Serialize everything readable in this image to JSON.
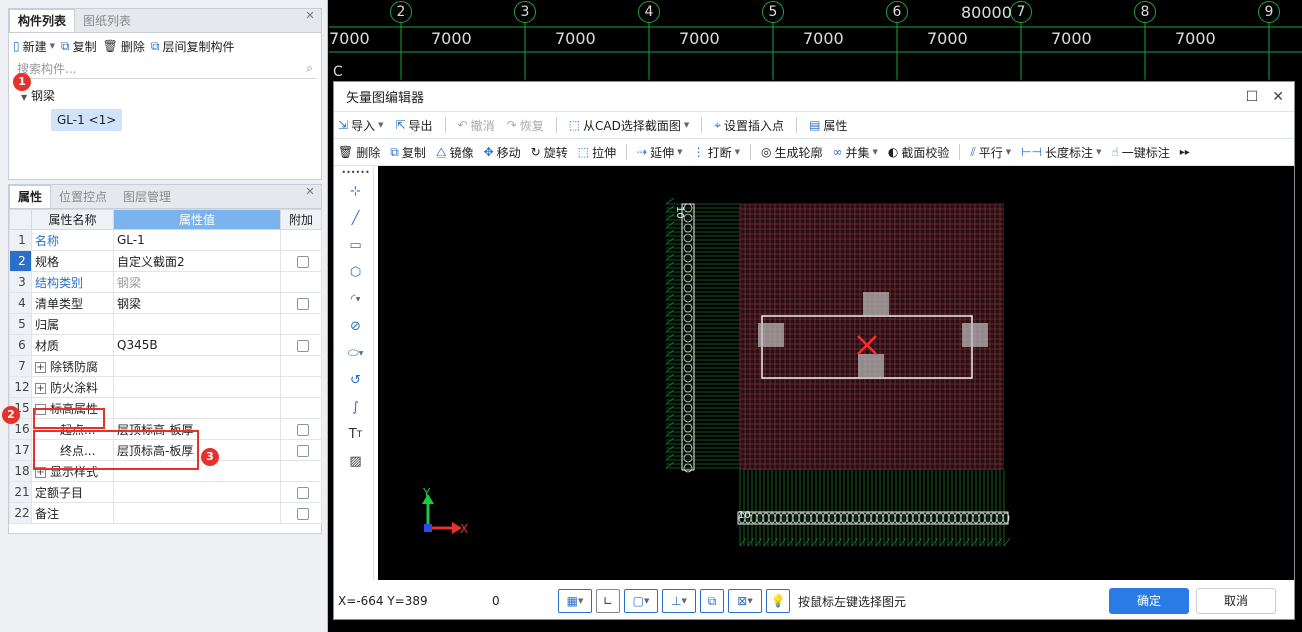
{
  "component_panel": {
    "tabs": [
      "构件列表",
      "图纸列表"
    ],
    "toolbar": {
      "new": "新建",
      "copy": "复制",
      "delete": "删除",
      "floor_copy": "层间复制构件"
    },
    "search_placeholder": "搜索构件...",
    "tree": {
      "group": "钢梁",
      "child": "GL-1 <1>"
    }
  },
  "property_panel": {
    "tabs": [
      "属性",
      "位置控点",
      "图层管理"
    ],
    "headers": {
      "name": "属性名称",
      "value": "属性值",
      "extra": "附加"
    },
    "rows": [
      {
        "num": "1",
        "name": "名称",
        "value": "GL-1"
      },
      {
        "num": "2",
        "name": "规格",
        "value": "自定义截面2"
      },
      {
        "num": "3",
        "name": "结构类别",
        "value": "钢梁"
      },
      {
        "num": "4",
        "name": "清单类型",
        "value": "钢梁"
      },
      {
        "num": "5",
        "name": "归属",
        "value": ""
      },
      {
        "num": "6",
        "name": "材质",
        "value": "Q345B"
      },
      {
        "num": "7",
        "name": "除锈防腐",
        "value": ""
      },
      {
        "num": "12",
        "name": "防火涂料",
        "value": ""
      },
      {
        "num": "15",
        "name": "标高属性",
        "value": ""
      },
      {
        "num": "16",
        "name": "起点...",
        "value": "层顶标高-板厚"
      },
      {
        "num": "17",
        "name": "终点...",
        "value": "层顶标高-板厚"
      },
      {
        "num": "18",
        "name": "显示样式",
        "value": ""
      },
      {
        "num": "21",
        "name": "定额子目",
        "value": ""
      },
      {
        "num": "22",
        "name": "备注",
        "value": ""
      }
    ]
  },
  "badges": [
    "1",
    "2",
    "3"
  ],
  "cad": {
    "axes": [
      "2",
      "3",
      "4",
      "5",
      "6",
      "7",
      "8",
      "9"
    ],
    "spans": [
      "7000",
      "7000",
      "7000",
      "7000",
      "7000",
      "7000",
      "7000",
      "7000"
    ],
    "total": "80000",
    "row_label": "C"
  },
  "dialog": {
    "title": "矢量图编辑器",
    "toolbar1": {
      "import": "导入",
      "export": "导出",
      "undo": "撤消",
      "redo": "恢复",
      "select_cad": "从CAD选择截面图",
      "set_insert": "设置插入点",
      "props": "属性"
    },
    "toolbar2": {
      "delete": "删除",
      "copy": "复制",
      "mirror": "镜像",
      "move": "移动",
      "rotate": "旋转",
      "stretch": "拉伸",
      "extend": "延伸",
      "break": "打断",
      "contour": "生成轮廓",
      "union": "并集",
      "check": "截面校验",
      "parallel": "平行",
      "length_dim": "长度标注",
      "auto_dim": "一键标注"
    },
    "canvas": {
      "axis_x": "X",
      "axis_y": "Y",
      "dim_left": "10",
      "dim_bottom": "10"
    },
    "status": {
      "coords": "X=-664 Y=389",
      "count": "0",
      "hint": "按鼠标左键选择图元"
    },
    "ok": "确定",
    "cancel": "取消"
  },
  "colors": {
    "accent": "#2a7be4",
    "badge": "#e5322b",
    "cad_green": "#1fa53a",
    "grid_red": "#b0525e"
  }
}
